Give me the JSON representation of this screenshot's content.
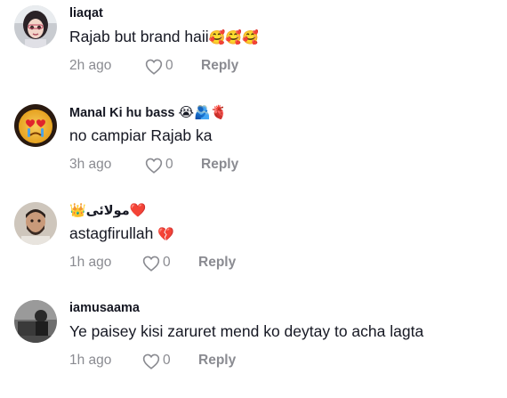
{
  "comments": [
    {
      "username": "liaqat",
      "text": "Rajab but brand haii",
      "text_emojis": "🥰🥰🥰",
      "time": "2h ago",
      "likes": "0",
      "reply_label": "Reply",
      "avatar": "avatar-photo-girl"
    },
    {
      "username": "Manal Ki hu bass",
      "username_emojis": "😭🫂🫀",
      "text": "no campiar Rajab ka",
      "time": "3h ago",
      "likes": "0",
      "reply_label": "Reply",
      "avatar": "avatar-crying-heart-eyes"
    },
    {
      "username": "مولائی",
      "username_emojis_before": "👑",
      "username_emojis_after": "❤️",
      "text": "astagfirullah",
      "text_emojis": "💔",
      "time": "1h ago",
      "likes": "0",
      "reply_label": "Reply",
      "avatar": "avatar-photo-man"
    },
    {
      "username": "iamusaama",
      "text": "Ye paisey kisi zaruret mend ko deytay to acha lagta",
      "time": "1h ago",
      "likes": "0",
      "reply_label": "Reply",
      "avatar": "avatar-photo-bw"
    }
  ],
  "colors": {
    "primary_text": "#161823",
    "secondary_text": "#8a8b91",
    "background": "#ffffff"
  },
  "icons": {
    "like": "heart-outline-icon"
  }
}
